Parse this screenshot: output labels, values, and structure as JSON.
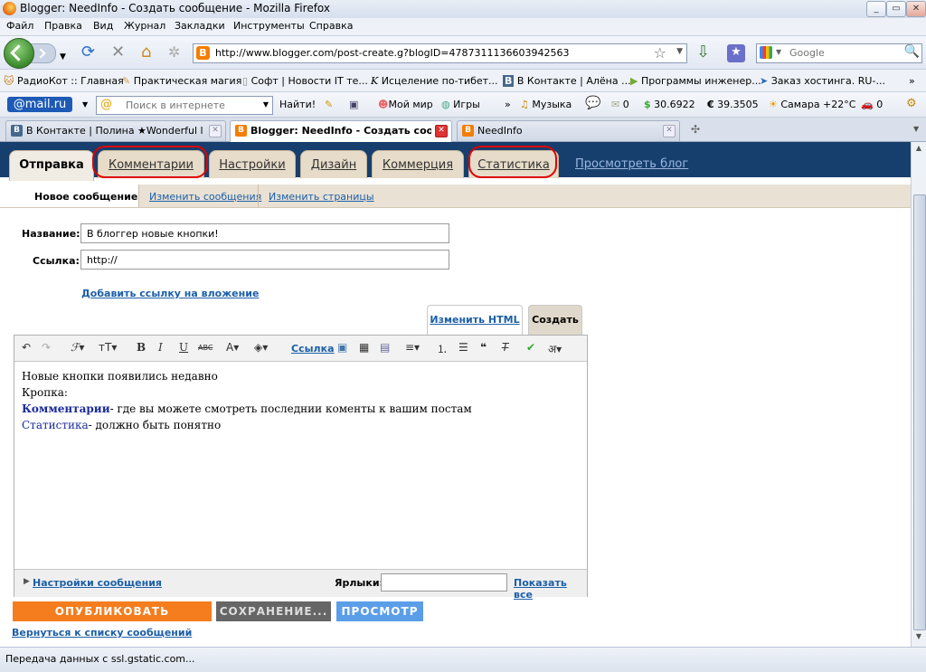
{
  "window": {
    "title": "Blogger: NeedInfo - Создать сообщение - Mozilla Firefox",
    "controls": [
      "_",
      "▭",
      "✕"
    ]
  },
  "menu": [
    "Файл",
    "Правка",
    "Вид",
    "Журнал",
    "Закладки",
    "Инструменты",
    "Справка"
  ],
  "navigation": {
    "url": "http://www.blogger.com/post-create.g?blogID=4787311136603942563",
    "search_placeholder": "Google"
  },
  "bookmarks": [
    "РадиоКот :: Главная",
    "Практическая магия",
    "Софт | Новости IT те...",
    "Исцеление по-тибет...",
    "В Контакте | Алёна ...",
    "Программы инженер...",
    "Заказ хостинга. RU-..."
  ],
  "mailbar": {
    "logo": "@mail.ru",
    "search_placeholder": "Поиск в интернете",
    "find_button": "Найти!",
    "my_world": "Мой мир",
    "games": "Игры",
    "music": "Музыка",
    "mail_count": "0",
    "usd": "30.6922",
    "eur": "39.3505",
    "weather": "Самара +22°C",
    "traffic": "0",
    "usd_symbol": "$",
    "eur_symbol": "€"
  },
  "tabs": [
    {
      "label": "В Контакте | Полина ★Wonderful life..."
    },
    {
      "label": "Blogger: NeedInfo - Создать соо..."
    },
    {
      "label": "NeedInfo"
    }
  ],
  "blogger": {
    "main_tabs": [
      "Отправка",
      "Комментарии",
      "Настройки",
      "Дизайн",
      "Коммерция",
      "Статистика"
    ],
    "view_blog": "Просмотреть блог",
    "sub_tabs": [
      "Новое сообщение",
      "Изменить сообщения",
      "Изменить страницы"
    ],
    "title_label": "Название:",
    "title_value": "В блоггер новые кнопки!",
    "link_label": "Ссылка:",
    "link_value": "http://",
    "add_attachment": "Добавить ссылку на вложение",
    "mode_html": "Изменить HTML",
    "mode_compose": "Создать",
    "toolbar_link": "Ссылка",
    "body": {
      "line1": "Новые кнопки появились недавно",
      "line2": "Кропка:",
      "comments_word": "Комментарии",
      "comments_rest": "- где вы можете смотреть последнии коменты к вашим постам",
      "stats_word": "Статистика",
      "stats_rest": "- должно быть понятно"
    },
    "post_settings": "Настройки сообщения",
    "labels_label": "Ярлыки:",
    "show_all": "Показать все",
    "publish": "ОПУБЛИКОВАТЬ СООБЩЕНИЕ",
    "saving": "СОХРАНЕНИЕ...",
    "preview": "ПРОСМОТР",
    "back_to_list": "Вернуться к списку сообщений"
  },
  "status": "Передача данных с ssl.gstatic.com...",
  "colors": {
    "blogger_header": "#163f6e",
    "publish": "#f57d1e",
    "saving": "#666666",
    "preview": "#5b9ee8",
    "annotation": "#e00000",
    "link": "#1c5fa8"
  }
}
